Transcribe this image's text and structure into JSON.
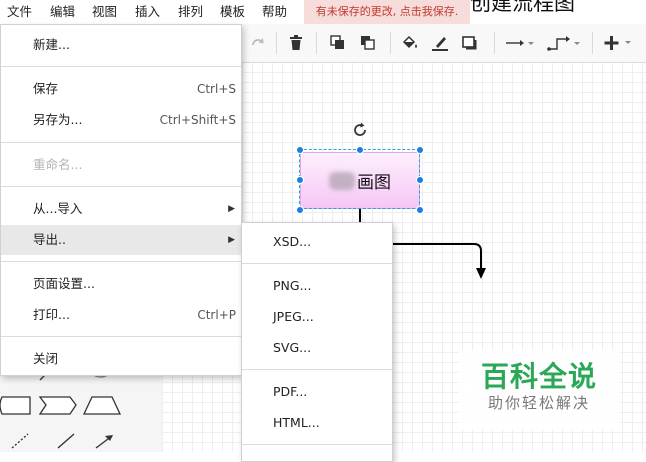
{
  "menubar": {
    "items": [
      "文件",
      "编辑",
      "视图",
      "插入",
      "排列",
      "模板",
      "帮助"
    ],
    "unsaved_notice": "有未保存的更改, 点击我保存.",
    "diagram_title": "创建流程图"
  },
  "file_menu": {
    "new": "新建...",
    "save": "保存",
    "save_shortcut": "Ctrl+S",
    "save_as": "另存为...",
    "save_as_shortcut": "Ctrl+Shift+S",
    "rename": "重命名...",
    "import_from": "从...导入",
    "export": "导出..",
    "page_setup": "页面设置...",
    "print": "打印...",
    "print_shortcut": "Ctrl+P",
    "close": "关闭"
  },
  "export_menu": {
    "items": [
      "XSD...",
      "PNG...",
      "JPEG...",
      "SVG...",
      "PDF...",
      "HTML..."
    ]
  },
  "canvas": {
    "shape_label": "画图"
  },
  "watermark": {
    "title": "百科全说",
    "subtitle": "助你轻松解决"
  },
  "colors": {
    "accent": "#1a7fe0",
    "selection": "#29a3d6",
    "shape_fill_top": "#fdf0fd",
    "shape_fill_bottom": "#f6c6f6",
    "notice_bg": "#f7dcdc",
    "notice_text": "#c0392b",
    "watermark_green": "#2aa858"
  }
}
